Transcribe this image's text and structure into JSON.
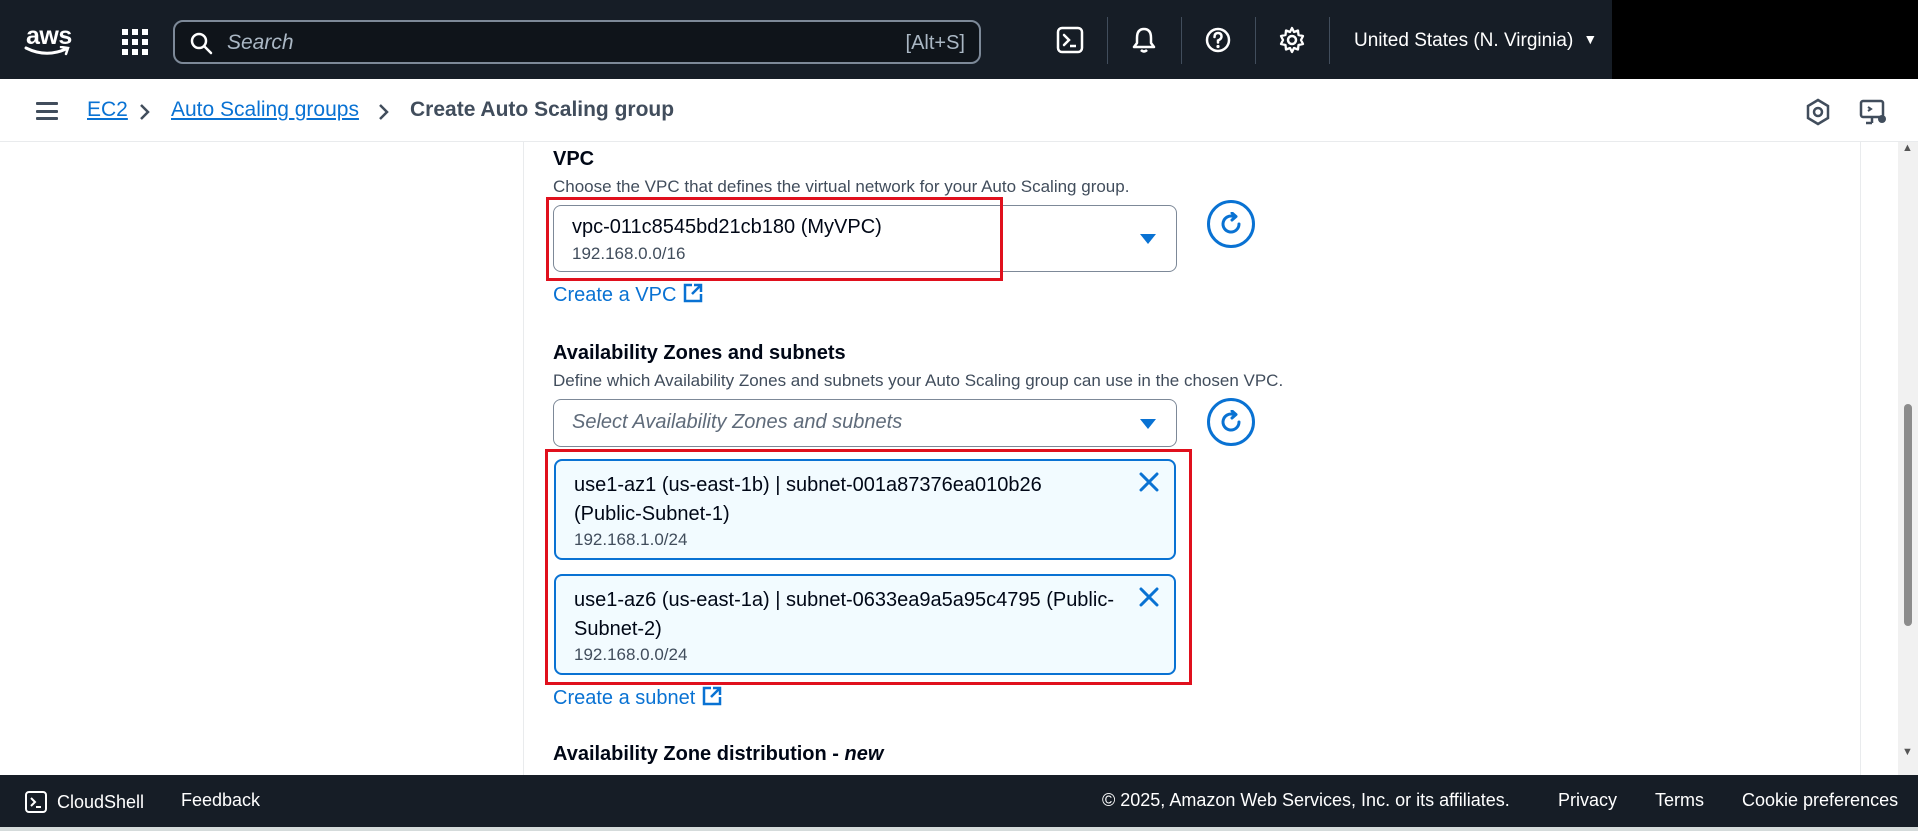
{
  "topnav": {
    "logo_text": "aws",
    "search_placeholder": "Search",
    "search_shortcut": "[Alt+S]",
    "icons": [
      "services-grid-icon",
      "cloudshell-icon",
      "notifications-bell-icon",
      "help-icon",
      "settings-gear-icon"
    ],
    "region": "United States (N. Virginia)"
  },
  "breadcrumb": {
    "items": [
      {
        "label": "EC2"
      },
      {
        "label": "Auto Scaling groups"
      }
    ],
    "current": "Create Auto Scaling group"
  },
  "form": {
    "vpc": {
      "label": "VPC",
      "description": "Choose the VPC that defines the virtual network for your Auto Scaling group.",
      "selected_value": "vpc-011c8545bd21cb180 (MyVPC)",
      "selected_cidr": "192.168.0.0/16",
      "create_link": "Create a VPC"
    },
    "az": {
      "label": "Availability Zones and subnets",
      "description": "Define which Availability Zones and subnets your Auto Scaling group can use in the chosen VPC.",
      "placeholder": "Select Availability Zones and subnets",
      "tokens": [
        {
          "title": "use1-az1 (us-east-1b) | subnet-001a87376ea010b26 (Public-Subnet-1)",
          "cidr": "192.168.1.0/24"
        },
        {
          "title": "use1-az6 (us-east-1a) | subnet-0633ea9a5a95c4795 (Public-Subnet-2)",
          "cidr": "192.168.0.0/24"
        }
      ],
      "create_link": "Create a subnet"
    },
    "distribution": {
      "label": "Availability Zone distribution - ",
      "label_new": "new"
    }
  },
  "footer": {
    "cloudshell": "CloudShell",
    "feedback": "Feedback",
    "copyright": "© 2025, Amazon Web Services, Inc. or its affiliates.",
    "privacy": "Privacy",
    "terms": "Terms",
    "cookie": "Cookie preferences"
  },
  "colors": {
    "nav_bg": "#161d26",
    "link": "#0972d3",
    "highlight": "#e0101d",
    "token_bg": "#f2fbff"
  }
}
